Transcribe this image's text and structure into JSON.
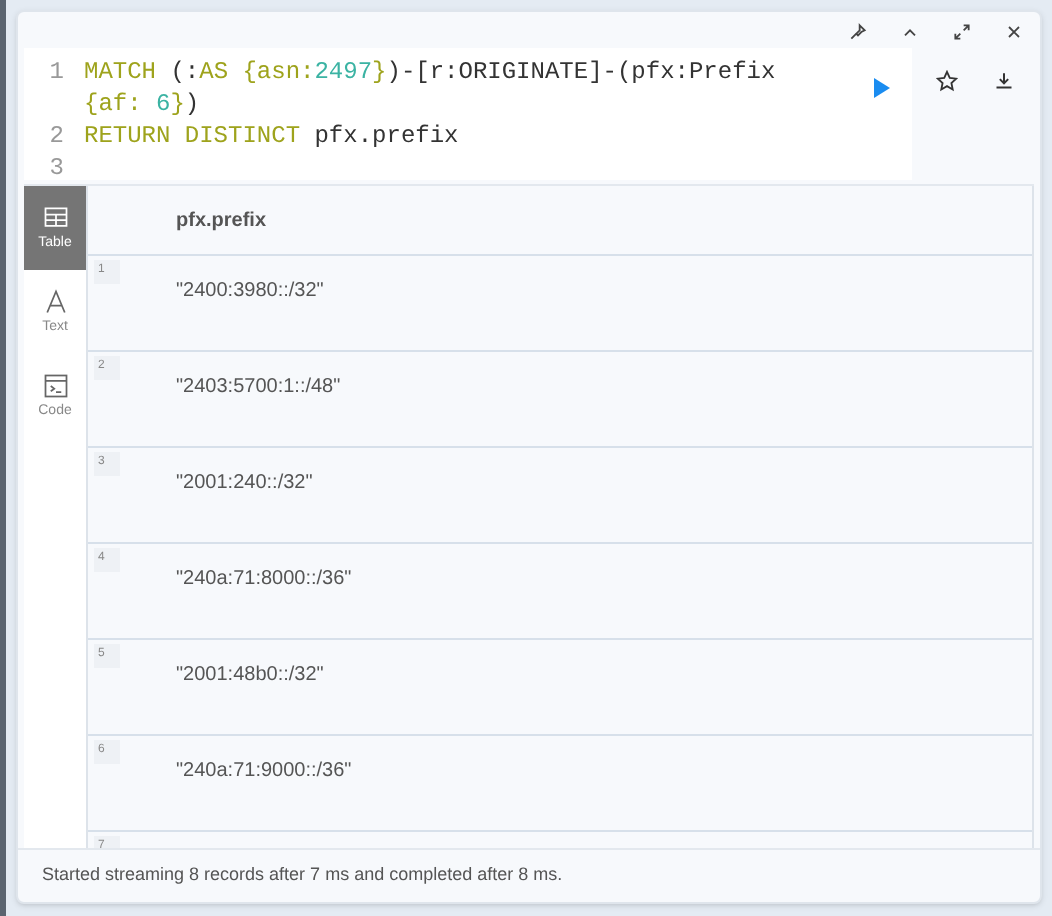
{
  "editor": {
    "lines": [
      {
        "number": "1",
        "tokens": [
          {
            "kind": "keyword",
            "text": "MATCH"
          },
          {
            "kind": "plain",
            "text": " (:"
          },
          {
            "kind": "keyword",
            "text": "AS {asn:"
          },
          {
            "kind": "number",
            "text": "2497"
          },
          {
            "kind": "keyword",
            "text": "}"
          },
          {
            "kind": "plain",
            "text": ")-[r:ORIGINATE]-(pfx:Prefix "
          },
          {
            "kind": "keyword",
            "text": "{af: "
          },
          {
            "kind": "number",
            "text": "6"
          },
          {
            "kind": "keyword",
            "text": "}"
          },
          {
            "kind": "plain",
            "text": ")"
          }
        ]
      },
      {
        "number": "2",
        "tokens": [
          {
            "kind": "keyword",
            "text": "RETURN DISTINCT"
          },
          {
            "kind": "plain",
            "text": " pfx.prefix"
          }
        ]
      },
      {
        "number": "3"
      }
    ]
  },
  "views": [
    {
      "label": "Table",
      "selected": true
    },
    {
      "label": "Text",
      "selected": false
    },
    {
      "label": "Code",
      "selected": false
    }
  ],
  "table": {
    "columns": [
      "pfx.prefix"
    ],
    "rows": [
      {
        "index": "1",
        "value": "\"2400:3980::/32\""
      },
      {
        "index": "2",
        "value": "\"2403:5700:1::/48\""
      },
      {
        "index": "3",
        "value": "\"2001:240::/32\""
      },
      {
        "index": "4",
        "value": "\"240a:71:8000::/36\""
      },
      {
        "index": "5",
        "value": "\"2001:48b0::/32\""
      },
      {
        "index": "6",
        "value": "\"240a:71:9000::/36\""
      },
      {
        "index": "7"
      }
    ]
  },
  "status_bar": "Started streaming 8 records after 7 ms and completed after 8 ms."
}
